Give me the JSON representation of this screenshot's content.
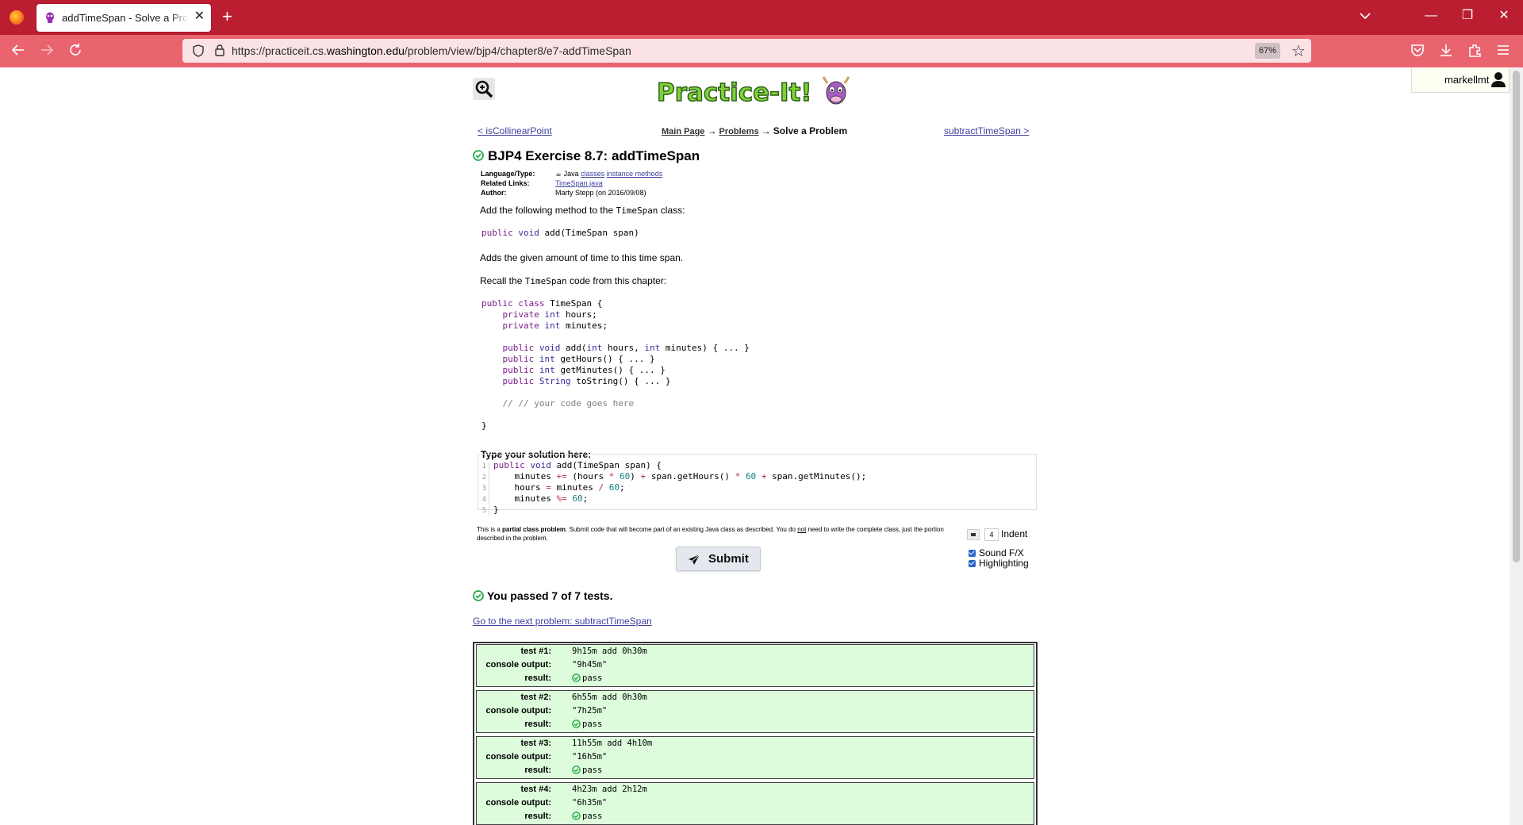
{
  "browser": {
    "tab_title": "addTimeSpan - Solve a Problem",
    "url_prefix": "https://practiceit.cs.",
    "url_domain": "washington.edu",
    "url_path": "/problem/view/bjp4/chapter8/e7-addTimeSpan",
    "zoom": "67%"
  },
  "header": {
    "username": "markellmt",
    "logo_text": "Practice-It!"
  },
  "nav": {
    "prev_link": "< isCollinearPoint",
    "next_link": "subtractTimeSpan >",
    "crumb_main": "Main Page",
    "crumb_problems": "Problems",
    "crumb_current": "Solve a Problem",
    "arrow": "→"
  },
  "problem": {
    "title": "BJP4 Exercise 8.7: addTimeSpan",
    "meta": {
      "language_label": "Language/Type:",
      "language_value": "Java",
      "tag1": "classes",
      "tag2": "instance methods",
      "related_label": "Related Links:",
      "related_value": "TimeSpan.java",
      "author_label": "Author:",
      "author_value": "Marty Stepp (on 2016/09/08)"
    },
    "intro_before": "Add the following method to the ",
    "intro_class": "TimeSpan",
    "intro_after": " class:",
    "signature": {
      "kw1": "public",
      "kw2": "void",
      "rest": " add(TimeSpan span)"
    },
    "desc": "Adds the given amount of time to this time span.",
    "recall_before": "Recall the ",
    "recall_class": "TimeSpan",
    "recall_after": " code from this chapter:",
    "class_code": {
      "l1_kw": "public class",
      "l1_rest": " TimeSpan {",
      "l2_kw1": "private",
      "l2_kw2": "int",
      "l2_rest": " hours;",
      "l3_kw1": "private",
      "l3_kw2": "int",
      "l3_rest": " minutes;",
      "l5_kw1": "public",
      "l5_kw2": "void",
      "l5_a": " add(",
      "l5_int1": "int",
      "l5_b": " hours, ",
      "l5_int2": "int",
      "l5_c": " minutes) { ... }",
      "l6_kw1": "public",
      "l6_kw2": "int",
      "l6_rest": " getHours() { ... }",
      "l7_kw1": "public",
      "l7_kw2": "int",
      "l7_rest": " getMinutes() { ... }",
      "l8_kw1": "public",
      "l8_kw2": "String",
      "l8_rest": " toString() { ... }",
      "comment": "// // your code goes here",
      "close": "}"
    }
  },
  "editor": {
    "label": "Type your solution here:",
    "line_numbers": [
      "1",
      "2",
      "3",
      "4",
      "5"
    ],
    "l1_kw1": "public",
    "l1_kw2": "void",
    "l1_rest": " add(TimeSpan span) {",
    "l2_a": "    minutes ",
    "l2_op1": "+=",
    "l2_b": " (hours ",
    "l2_op2": "*",
    "l2_sp": " ",
    "l2_n1": "60",
    "l2_c": ") ",
    "l2_op3": "+",
    "l2_d": " span.getHours() ",
    "l2_op4": "*",
    "l2_sp2": " ",
    "l2_n2": "60",
    "l2_sp3": " ",
    "l2_op5": "+",
    "l2_e": " span.getMinutes();",
    "l3_a": "    hours ",
    "l3_op1": "=",
    "l3_b": " minutes ",
    "l3_op2": "/",
    "l3_sp": " ",
    "l3_n": "60",
    "l3_c": ";",
    "l4_a": "    minutes ",
    "l4_op": "%=",
    "l4_sp": " ",
    "l4_n": "60",
    "l4_c": ";",
    "l5": "}"
  },
  "partial_note": {
    "pre": "This is a ",
    "bold": "partial class problem",
    "mid": ". Submit code that will become part of an existing Java class as described. You do ",
    "not": "not",
    "post": " need to write the complete class, just the portion described in the problem."
  },
  "options": {
    "indent_value": "4",
    "indent_label": "Indent",
    "sound_label": "Sound F/X",
    "highlight_label": "Highlighting"
  },
  "submit_label": "Submit",
  "result": {
    "summary": "You passed 7 of 7 tests.",
    "next_link": "Go to the next problem: subtractTimeSpan"
  },
  "tests": [
    {
      "label": "test #1:",
      "input": "9h15m add 0h30m",
      "output_label": "console output:",
      "output": "\"9h45m\"",
      "result_label": "result:",
      "result": "pass"
    },
    {
      "label": "test #2:",
      "input": "6h55m add 0h30m",
      "output_label": "console output:",
      "output": "\"7h25m\"",
      "result_label": "result:",
      "result": "pass"
    },
    {
      "label": "test #3:",
      "input": "11h55m add 4h10m",
      "output_label": "console output:",
      "output": "\"16h5m\"",
      "result_label": "result:",
      "result": "pass"
    },
    {
      "label": "test #4:",
      "input": "4h23m add 2h12m",
      "output_label": "console output:",
      "output": "\"6h35m\"",
      "result_label": "result:",
      "result": "pass"
    }
  ],
  "colors": {
    "tabbar": "#bb1e31",
    "navbar": "#e9646f",
    "pass_bg": "#dcfcdc",
    "pass_green": "#2aa84a"
  }
}
